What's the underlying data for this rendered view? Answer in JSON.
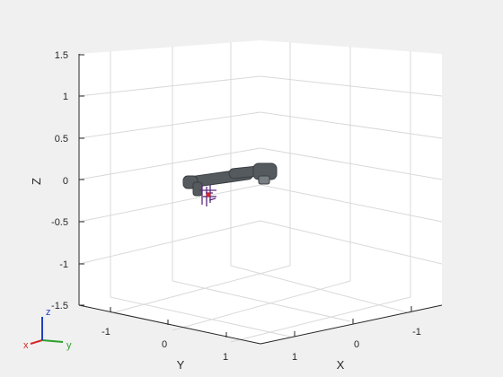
{
  "figure": {
    "background": "#f0f0f0",
    "axes_background": "#ffffff"
  },
  "axes": {
    "z_label": "Z",
    "x_label": "X",
    "y_label": "Y",
    "z_ticks": [
      "1.5",
      "1",
      "0.5",
      "0",
      "-0.5",
      "-1",
      "-1.5"
    ],
    "y_ticks": [
      "-1",
      "0",
      "1"
    ],
    "x_ticks": [
      "1",
      "0",
      "-1"
    ]
  },
  "triad": {
    "x": "x",
    "y": "y",
    "z": "z",
    "x_color": "#d62728",
    "y_color": "#2ca02c",
    "z_color": "#1f3fbf"
  },
  "robot": {
    "link_color": "#555a5f",
    "frame_color": "#5a2a7a"
  }
}
